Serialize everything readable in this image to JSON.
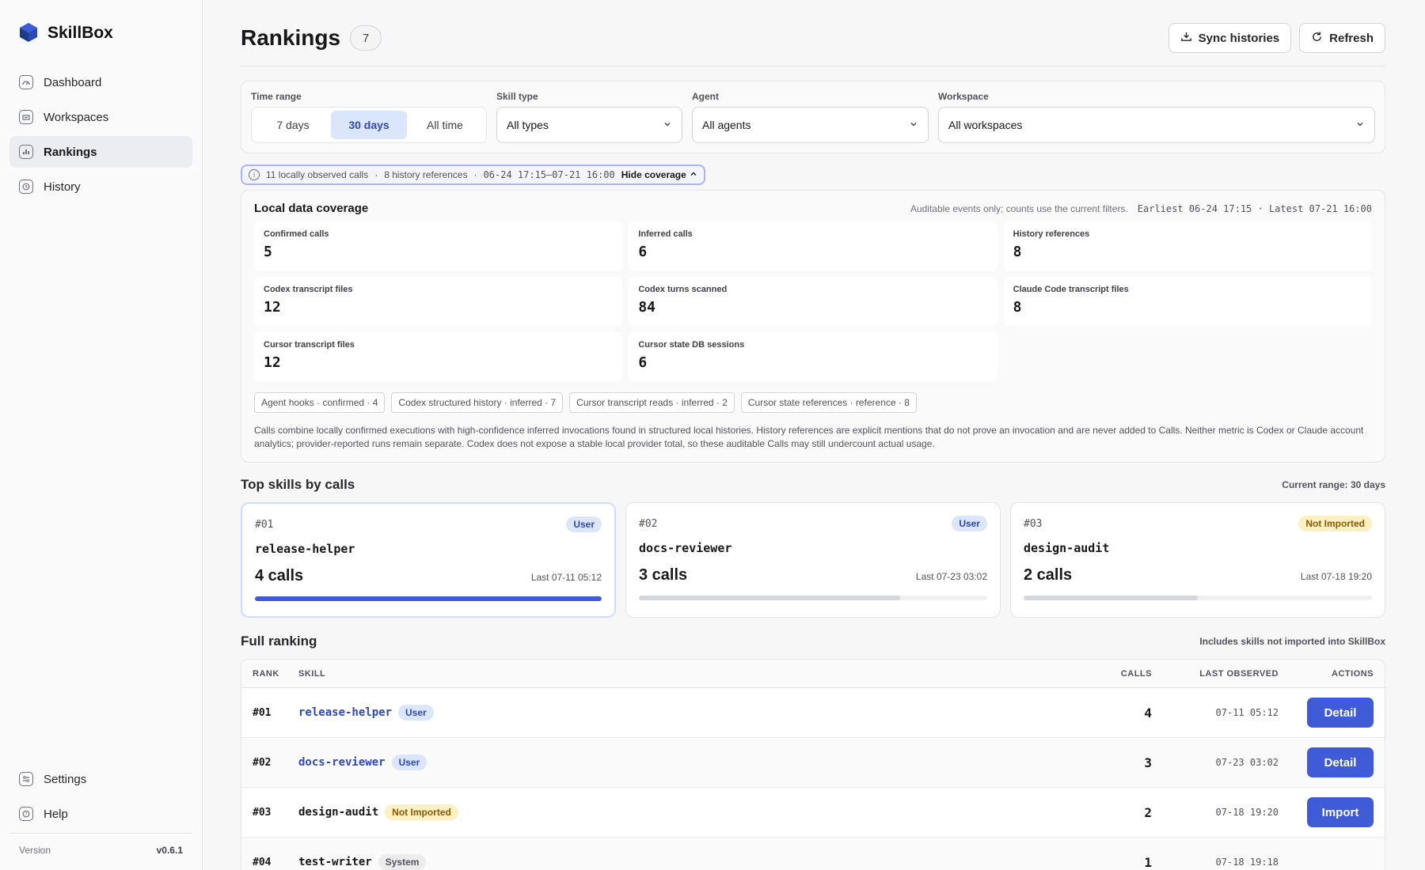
{
  "app": {
    "name": "SkillBox",
    "version_label": "Version",
    "version": "v0.6.1"
  },
  "sidebar": {
    "items": [
      {
        "label": "Dashboard",
        "icon": "gauge-icon"
      },
      {
        "label": "Workspaces",
        "icon": "folder-icon"
      },
      {
        "label": "Rankings",
        "icon": "bar-chart-icon",
        "active": true
      },
      {
        "label": "History",
        "icon": "history-icon"
      }
    ],
    "bottom": [
      {
        "label": "Settings",
        "icon": "sliders-icon"
      },
      {
        "label": "Help",
        "icon": "help-icon"
      }
    ]
  },
  "header": {
    "title": "Rankings",
    "count": "7",
    "sync_label": "Sync histories",
    "refresh_label": "Refresh"
  },
  "filters": {
    "time_label": "Time range",
    "time_options": [
      "7 days",
      "30 days",
      "All time"
    ],
    "time_selected": "30 days",
    "skill_type_label": "Skill type",
    "skill_type_value": "All types",
    "agent_label": "Agent",
    "agent_value": "All agents",
    "workspace_label": "Workspace",
    "workspace_value": "All workspaces"
  },
  "coverage_toggle": {
    "observed": "11 locally observed calls",
    "references": "8 history references",
    "range": "06-24 17:15–07-21 16:00",
    "hide_label": "Hide coverage"
  },
  "coverage": {
    "title": "Local data coverage",
    "note": "Auditable events only; counts use the current filters.",
    "earliest_latest": "Earliest 06-24 17:15 · Latest 07-21 16:00",
    "metrics": [
      {
        "label": "Confirmed calls",
        "value": "5"
      },
      {
        "label": "Inferred calls",
        "value": "6"
      },
      {
        "label": "History references",
        "value": "8"
      },
      {
        "label": "Codex transcript files",
        "value": "12"
      },
      {
        "label": "Codex turns scanned",
        "value": "84"
      },
      {
        "label": "Claude Code transcript files",
        "value": "8"
      },
      {
        "label": "Cursor transcript files",
        "value": "12"
      },
      {
        "label": "Cursor state DB sessions",
        "value": "6"
      }
    ],
    "tags": [
      "Agent hooks · confirmed · 4",
      "Codex structured history · inferred · 7",
      "Cursor transcript reads · inferred · 2",
      "Cursor state references · reference · 8"
    ],
    "description": "Calls combine locally confirmed executions with high-confidence inferred invocations found in structured local histories. History references are explicit mentions that do not prove an invocation and are never added to Calls. Neither metric is Codex or Claude account analytics; provider-reported runs remain separate. Codex does not expose a stable local provider total, so these auditable Calls may still undercount actual usage."
  },
  "top_skills": {
    "title": "Top skills by calls",
    "note": "Current range: 30 days",
    "cards": [
      {
        "rank": "#01",
        "badge": "User",
        "skill": "release-helper",
        "calls": "4 calls",
        "last": "Last 07-11 05:12",
        "share": 1.0
      },
      {
        "rank": "#02",
        "badge": "User",
        "skill": "docs-reviewer",
        "calls": "3 calls",
        "last": "Last 07-23 03:02",
        "share": 0.75
      },
      {
        "rank": "#03",
        "badge": "Not Imported",
        "skill": "design-audit",
        "calls": "2 calls",
        "last": "Last 07-18 19:20",
        "share": 0.5
      }
    ]
  },
  "full_ranking": {
    "title": "Full ranking",
    "note": "Includes skills not imported into SkillBox",
    "columns": [
      "RANK",
      "SKILL",
      "CALLS",
      "LAST OBSERVED",
      "ACTIONS"
    ],
    "rows": [
      {
        "rank": "#01",
        "skill": "release-helper",
        "badge": "User",
        "calls": "4",
        "last": "07-11 05:12",
        "action": "Detail"
      },
      {
        "rank": "#02",
        "skill": "docs-reviewer",
        "badge": "User",
        "calls": "3",
        "last": "07-23 03:02",
        "action": "Detail"
      },
      {
        "rank": "#03",
        "skill": "design-audit",
        "badge": "Not Imported",
        "calls": "2",
        "last": "07-18 19:20",
        "action": "Import"
      },
      {
        "rank": "#04",
        "skill": "test-writer",
        "badge": "System",
        "calls": "1",
        "last": "07-18 19:18",
        "action": ""
      }
    ]
  },
  "colors": {
    "accent": "#3f5bd8",
    "accent_soft": "#dbe6fb",
    "warning_soft": "#fdf0c4"
  }
}
